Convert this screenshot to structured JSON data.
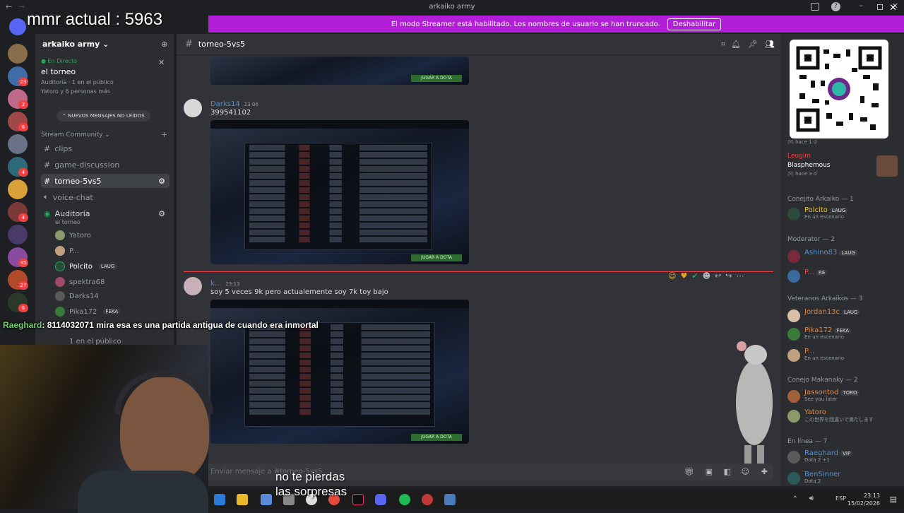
{
  "window": {
    "title": "arkaiko army"
  },
  "overlay": {
    "mmr": "mmr actual : 5963"
  },
  "banner": {
    "text": "El modo Streamer está habilitado. Los nombres de usuario se han truncado.",
    "button": "Deshabilitar"
  },
  "servers": {
    "badges": [
      "23",
      "2",
      "6",
      "4",
      "4",
      "35",
      "27",
      "6"
    ]
  },
  "sidebar": {
    "server_name": "arkaiko army",
    "live": {
      "label": "En Directo",
      "title": "el torneo",
      "meta": "Auditoría",
      "audience": "1 en el público",
      "people": "Yatoro y 6 personas más"
    },
    "new_messages": "NUEVOS MENSAJES NO LEÍDOS",
    "category": "Stream Community",
    "channels": [
      {
        "name": "clips",
        "type": "text"
      },
      {
        "name": "game-discussion",
        "type": "text"
      },
      {
        "name": "torneo-5vs5",
        "type": "text",
        "selected": true
      },
      {
        "name": "voice-chat",
        "type": "voice"
      },
      {
        "name": "Auditoría",
        "type": "stage",
        "subtitle": "el torneo"
      }
    ],
    "voice_users": [
      {
        "name": "Yatoro",
        "tag": ""
      },
      {
        "name": "P...",
        "tag": ""
      },
      {
        "name": "Polcito",
        "tag": "LAUG"
      },
      {
        "name": "spektra68",
        "tag": ""
      },
      {
        "name": "Darks14",
        "tag": ""
      },
      {
        "name": "Pika172",
        "tag": "FEKA"
      }
    ],
    "audience_count": "1 en el público"
  },
  "chat": {
    "channel": "torneo-5vs5",
    "messages": [
      {
        "author": "Darks14",
        "time": "23:06",
        "text": "399541102",
        "button": "JUGAR A DOTA"
      },
      {
        "author": "k...",
        "time": "23:13",
        "text": "soy 5 veces 9k pero actualemente soy 7k toy bajo",
        "button": "JUGAR A DOTA"
      }
    ],
    "top_button": "JUGAR A DOTA",
    "composer_placeholder": "Enviar mensaje a #torneo-5vs5"
  },
  "members": {
    "top_item": {
      "status": "hace 1 d"
    },
    "leugim": {
      "name": "Leugim",
      "activity": "Blasphemous",
      "status": "hace 3 d"
    },
    "groups": [
      {
        "title": "Conejito Arkaiko — 1",
        "members": [
          {
            "name": "Polcito",
            "tag": "LAUG",
            "status": "En un escenario"
          }
        ]
      },
      {
        "title": "Moderator — 2",
        "members": [
          {
            "name": "Ashino83",
            "tag": "LAUG",
            "status": ""
          },
          {
            "name": "P...",
            "tag": "RE",
            "status": ""
          }
        ]
      },
      {
        "title": "Veteranos Arkaikos — 3",
        "members": [
          {
            "name": "Jordan13c",
            "tag": "LAUG",
            "status": ""
          },
          {
            "name": "Pika172",
            "tag": "FEKA",
            "status": "En un escenario"
          },
          {
            "name": "P...",
            "tag": "",
            "status": "En un escenario"
          }
        ]
      },
      {
        "title": "Conejo Makanaky — 2",
        "members": [
          {
            "name": "Jassontod",
            "tag": "TORO",
            "status": "See you later"
          },
          {
            "name": "Yatoro",
            "tag": "",
            "status": "この世界を間違いで満たします"
          }
        ]
      },
      {
        "title": "En línea — 7",
        "members": [
          {
            "name": "Raeghard",
            "tag": "VIP",
            "status": "Dota 2 +1"
          },
          {
            "name": "BenSinner",
            "tag": "",
            "status": "Dota 2"
          }
        ]
      }
    ]
  },
  "stream": {
    "chat_user": "Raeghard",
    "chat_text": ": 8114032071 mira esa es una partida antigua de cuando era inmortal",
    "subtitle_1": "no te pierdas",
    "subtitle_2": "las sorpresas"
  },
  "taskbar": {
    "lang": "ESP",
    "time": "23:13",
    "date": "15/02/2026"
  },
  "colors": {
    "banner": "#b31fd8",
    "accent": "#5865f2",
    "online": "#23a55a",
    "alert": "#f23f42"
  }
}
